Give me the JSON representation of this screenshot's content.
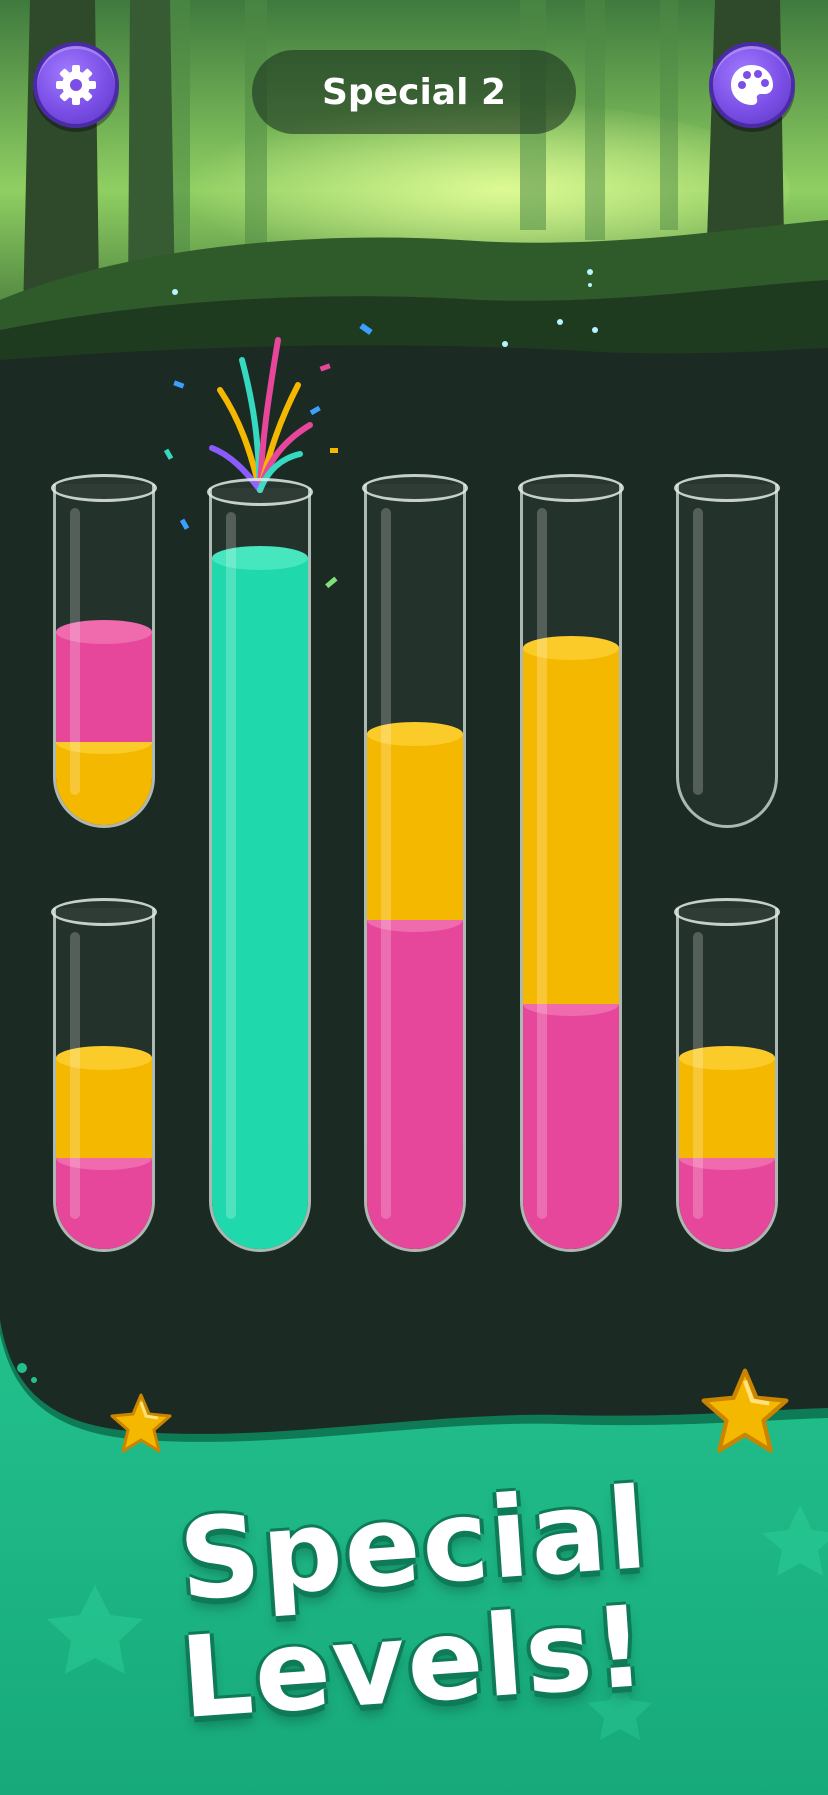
{
  "header": {
    "level_title": "Special 2",
    "settings_icon": "gear-icon",
    "theme_icon": "palette-icon"
  },
  "tubes": [
    {
      "name": "tube-1",
      "layers_bottom_to_top": [
        "yellow",
        "pink"
      ]
    },
    {
      "name": "tube-2",
      "layers_bottom_to_top": [
        "teal"
      ],
      "completed": true
    },
    {
      "name": "tube-3",
      "layers_bottom_to_top": [
        "pink",
        "yellow"
      ]
    },
    {
      "name": "tube-4",
      "layers_bottom_to_top": [
        "pink",
        "yellow"
      ]
    },
    {
      "name": "tube-5",
      "layers_bottom_to_top": []
    },
    {
      "name": "tube-6",
      "layers_bottom_to_top": [
        "pink",
        "yellow"
      ]
    },
    {
      "name": "tube-7",
      "layers_bottom_to_top": [
        "pink",
        "yellow"
      ]
    }
  ],
  "colors": {
    "pink": "#e6479a",
    "yellow": "#f5b800",
    "teal": "#1fd9ad",
    "banner_green": "#1fb585",
    "button_purple": "#7b4fe6"
  },
  "banner": {
    "line1": "Special",
    "line2": "Levels!"
  }
}
